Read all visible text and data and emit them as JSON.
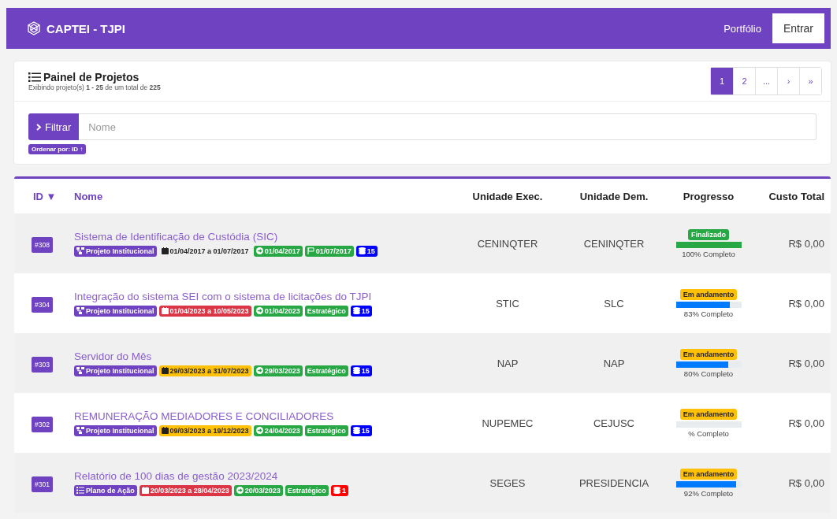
{
  "navbar": {
    "brand": "CAPTEI - TJPI",
    "links": [
      "Portfólio"
    ],
    "login_button": "Entrar"
  },
  "panel": {
    "title": "Painel de Projetos",
    "subtitle": "Exibindo projeto(s) **1 - 25** de um total de **225**",
    "pagination": [
      {
        "label": "1",
        "selected": true
      },
      {
        "label": "2",
        "selected": false
      },
      {
        "label": "...",
        "selected": false
      },
      {
        "label": "›",
        "selected": false
      },
      {
        "label": "»",
        "selected": false
      }
    ],
    "filter_button": "Filtrar",
    "search": {
      "placeholder": "Nome"
    },
    "sort_badge": "Ordenar por: ID ↑"
  },
  "table": {
    "columns": [
      "ID ▼",
      "Nome",
      "Unidade Exec.",
      "Unidade Dem.",
      "Progresso",
      "Custo Total"
    ],
    "rows": [
      {
        "id": "#308",
        "name": "Sistema de Identificação de Custódia (SIC)",
        "badges": [
          {
            "kind": "project",
            "text": "Projeto Institucional",
            "color": "#6f42c1"
          },
          {
            "kind": "period",
            "text": "01/04/2017 a 01/07/2017",
            "color": "#f0f0f0"
          },
          {
            "kind": "start",
            "text": "01/04/2017",
            "color": "#28a745"
          },
          {
            "kind": "end",
            "text": "01/07/2017",
            "color": "#28a745"
          },
          {
            "kind": "count",
            "text": "15",
            "color": "#0000ff"
          }
        ],
        "exec": "CENINQTER",
        "dem": "CENINQTER",
        "status": {
          "kind": "done",
          "text": "Finalizado"
        },
        "level": 1,
        "progress_text": "100% Completo",
        "cost": "R$ 0,00"
      },
      {
        "id": "#304",
        "name": "Integração do sistema SEI com o sistema de licitações do TJPI",
        "badges": [
          {
            "kind": "project",
            "text": "Projeto Institucional",
            "color": "#6f42c1"
          },
          {
            "kind": "period",
            "text": "01/04/2023 a 10/05/2023",
            "color": "#dc3545"
          },
          {
            "kind": "start",
            "text": "01/04/2023",
            "color": "#28a745"
          },
          {
            "kind": "tag",
            "text": "Estratégico",
            "color": "#28a745"
          },
          {
            "kind": "count",
            "text": "15",
            "color": "#0000ff"
          }
        ],
        "exec": "STIC",
        "dem": "SLC",
        "status": {
          "kind": "ongoing",
          "text": "Em andamento"
        },
        "level": 0.83,
        "progress_text": "83% Completo",
        "cost": "R$ 0,00"
      },
      {
        "id": "#303",
        "name": "Servidor do Mês",
        "badges": [
          {
            "kind": "project",
            "text": "Projeto Institucional",
            "color": "#6f42c1"
          },
          {
            "kind": "period",
            "text": "29/03/2023 a 31/07/2023",
            "color": "#ffc107"
          },
          {
            "kind": "start",
            "text": "29/03/2023",
            "color": "#28a745"
          },
          {
            "kind": "tag",
            "text": "Estratégico",
            "color": "#28a745"
          },
          {
            "kind": "count",
            "text": "15",
            "color": "#0000ff"
          }
        ],
        "exec": "NAP",
        "dem": "NAP",
        "status": {
          "kind": "ongoing",
          "text": "Em andamento"
        },
        "level": 0.8,
        "progress_text": "80% Completo",
        "cost": "R$ 0,00"
      },
      {
        "id": "#302",
        "name": "REMUNERAÇÃO MEDIADORES E CONCILIADORES",
        "badges": [
          {
            "kind": "project",
            "text": "Projeto Institucional",
            "color": "#6f42c1"
          },
          {
            "kind": "period",
            "text": "09/03/2023 a 19/12/2023",
            "color": "#ffc107"
          },
          {
            "kind": "start",
            "text": "24/04/2023",
            "color": "#28a745"
          },
          {
            "kind": "tag",
            "text": "Estratégico",
            "color": "#28a745"
          },
          {
            "kind": "count",
            "text": "15",
            "color": "#0000ff"
          }
        ],
        "exec": "NUPEMEC",
        "dem": "CEJUSC",
        "status": {
          "kind": "ongoing",
          "text": "Em andamento"
        },
        "progress_text": "% Completo",
        "cost": "R$ 0,00"
      },
      {
        "id": "#301",
        "name": "Relatório de 100 dias de gestão 2023/2024",
        "badges": [
          {
            "kind": "plan",
            "text": "Plano de Ação",
            "color": "#6f42c1"
          },
          {
            "kind": "period",
            "text": "20/03/2023 a 28/04/2023",
            "color": "#dc3545"
          },
          {
            "kind": "start",
            "text": "20/03/2023",
            "color": "#28a745"
          },
          {
            "kind": "tag",
            "text": "Estratégico",
            "color": "#28a745"
          },
          {
            "kind": "count",
            "text": "1",
            "color": "#ff0000"
          }
        ],
        "exec": "SEGES",
        "dem": "PRESIDENCIA",
        "status": {
          "kind": "ongoing",
          "text": "Em andamento"
        },
        "level": 0.92,
        "progress_text": "92% Completo",
        "cost": "R$ 0,00"
      }
    ]
  }
}
